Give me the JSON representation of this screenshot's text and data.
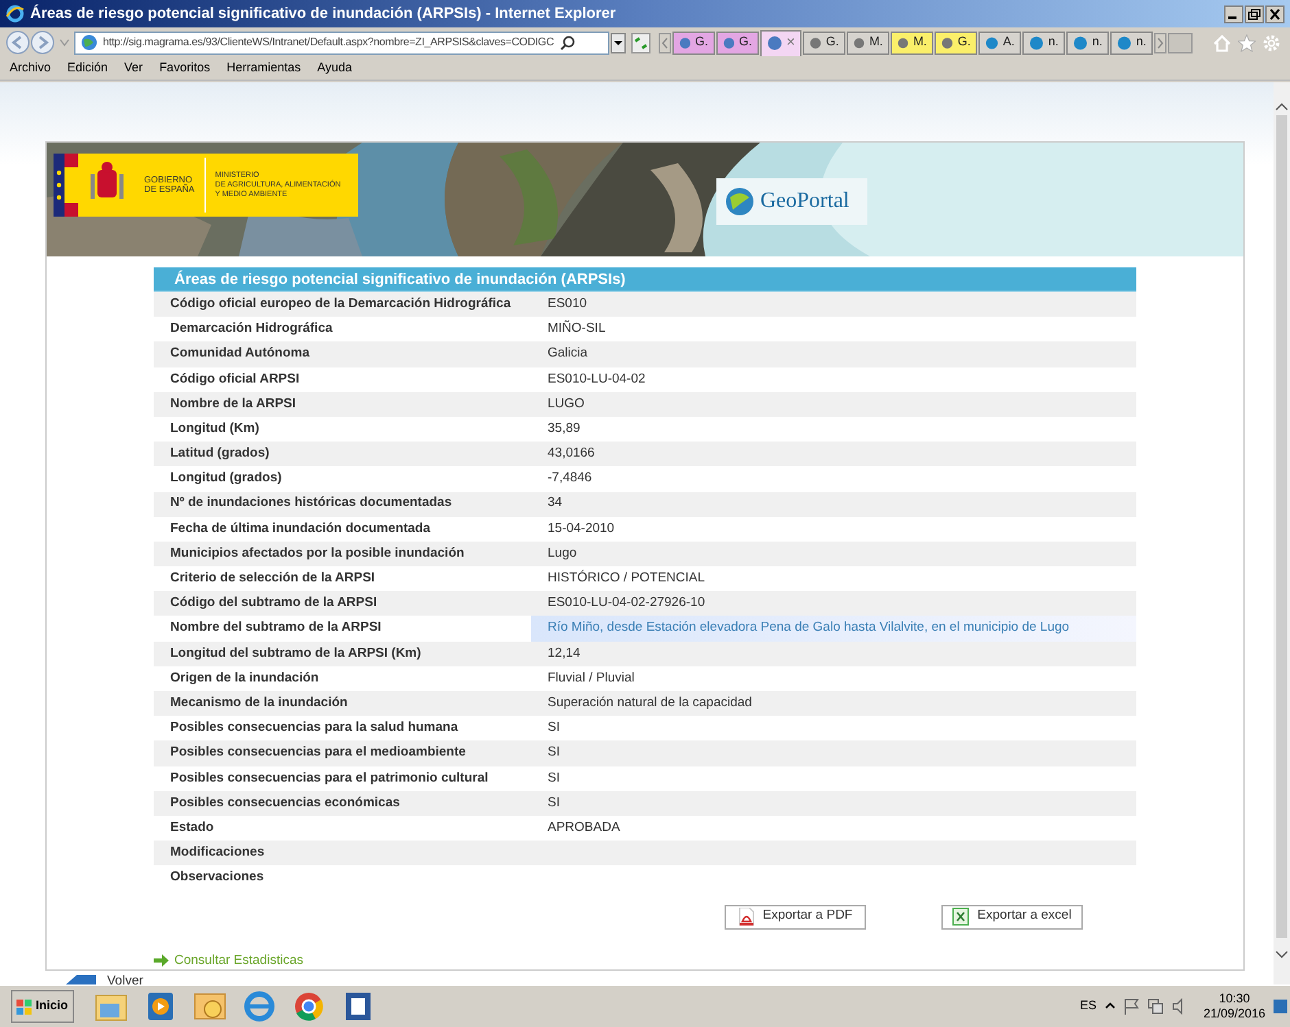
{
  "window": {
    "title": "Áreas de riesgo potencial significativo de inundación (ARPSIs) - Internet Explorer"
  },
  "address": {
    "url": "http://sig.magrama.es/93/ClienteWS/Intranet/Default.aspx?nombre=ZI_ARPSIS&claves=CODIGC"
  },
  "tabs": [
    {
      "label": "G.",
      "color": "#e3a6e3",
      "selected": false
    },
    {
      "label": "G.",
      "color": "#e3a6e3",
      "selected": false
    },
    {
      "label": "×",
      "color": "#f3d6f3",
      "selected": true
    },
    {
      "label": "G.",
      "color": "#d6d3ce",
      "selected": false
    },
    {
      "label": "M.",
      "color": "#d6d3ce",
      "selected": false
    },
    {
      "label": "M.",
      "color": "#fbef6a",
      "selected": false
    },
    {
      "label": "G.",
      "color": "#fbef6a",
      "selected": false
    },
    {
      "label": "A.",
      "color": "#d6d3ce",
      "selected": false
    },
    {
      "label": "n.",
      "color": "#d6d3ce",
      "selected": false
    },
    {
      "label": "n.",
      "color": "#d6d3ce",
      "selected": false
    },
    {
      "label": "n.",
      "color": "#d6d3ce",
      "selected": false
    }
  ],
  "menu": [
    "Archivo",
    "Edición",
    "Ver",
    "Favoritos",
    "Herramientas",
    "Ayuda"
  ],
  "banner": {
    "gov_line1": "GOBIERNO",
    "gov_line2": "DE ESPAÑA",
    "ministry_lines": [
      "MINISTERIO",
      "DE AGRICULTURA, ALIMENTACIÓN",
      "Y MEDIO AMBIENTE"
    ],
    "portal": "GeoPortal"
  },
  "table": {
    "title": "Áreas de riesgo potencial significativo de inundación (ARPSIs)",
    "rows": [
      {
        "label": "Código oficial europeo de la Demarcación Hidrográfica",
        "value": "ES010",
        "highlighted": false
      },
      {
        "label": "Demarcación Hidrográfica",
        "value": "MIÑO-SIL",
        "highlighted": false
      },
      {
        "label": "Comunidad Autónoma",
        "value": "Galicia",
        "highlighted": false
      },
      {
        "label": "Código oficial ARPSI",
        "value": "ES010-LU-04-02",
        "highlighted": false
      },
      {
        "label": "Nombre de la ARPSI",
        "value": "LUGO",
        "highlighted": false
      },
      {
        "label": "Longitud (Km)",
        "value": "35,89",
        "highlighted": false
      },
      {
        "label": "Latitud (grados)",
        "value": "43,0166",
        "highlighted": false
      },
      {
        "label": "Longitud (grados)",
        "value": "-7,4846",
        "highlighted": false
      },
      {
        "label": "Nº de inundaciones históricas documentadas",
        "value": "34",
        "highlighted": false
      },
      {
        "label": "Fecha de última inundación documentada",
        "value": "15-04-2010",
        "highlighted": false
      },
      {
        "label": "Municipios afectados por la posible inundación",
        "value": "Lugo",
        "highlighted": false
      },
      {
        "label": "Criterio de selección de la ARPSI",
        "value": "HISTÓRICO / POTENCIAL",
        "highlighted": false
      },
      {
        "label": "Código del subtramo de la ARPSI",
        "value": "ES010-LU-04-02-27926-10",
        "highlighted": false
      },
      {
        "label": "Nombre del subtramo de la ARPSI",
        "value": "Río Miño, desde Estación elevadora Pena de Galo hasta Vilalvite, en el municipio de Lugo",
        "highlighted": true
      },
      {
        "label": "Longitud del subtramo de la ARPSI (Km)",
        "value": "12,14",
        "highlighted": false
      },
      {
        "label": "Origen de la inundación",
        "value": "Fluvial / Pluvial",
        "highlighted": false
      },
      {
        "label": "Mecanismo de la inundación",
        "value": "Superación natural de la capacidad",
        "highlighted": false
      },
      {
        "label": "Posibles consecuencias para la salud humana",
        "value": "SI",
        "highlighted": false
      },
      {
        "label": "Posibles consecuencias para el medioambiente",
        "value": "SI",
        "highlighted": false
      },
      {
        "label": "Posibles consecuencias para el patrimonio cultural",
        "value": "SI",
        "highlighted": false
      },
      {
        "label": "Posibles consecuencias económicas",
        "value": "SI",
        "highlighted": false
      },
      {
        "label": "Estado",
        "value": "APROBADA",
        "highlighted": false
      },
      {
        "label": "Modificaciones",
        "highlighted": false
      },
      {
        "label": "Observaciones",
        "highlighted": false
      }
    ]
  },
  "buttons": [
    {
      "kind": "pdf",
      "label": "Exportar a PDF"
    },
    {
      "kind": "excel",
      "label": "Exportar a excel"
    }
  ],
  "stats_link": "Consultar Estadisticas",
  "back_link": "Volver",
  "taskbar": {
    "start": "Inicio",
    "language": "ES",
    "time": "10:30",
    "date": "21/09/2016"
  }
}
